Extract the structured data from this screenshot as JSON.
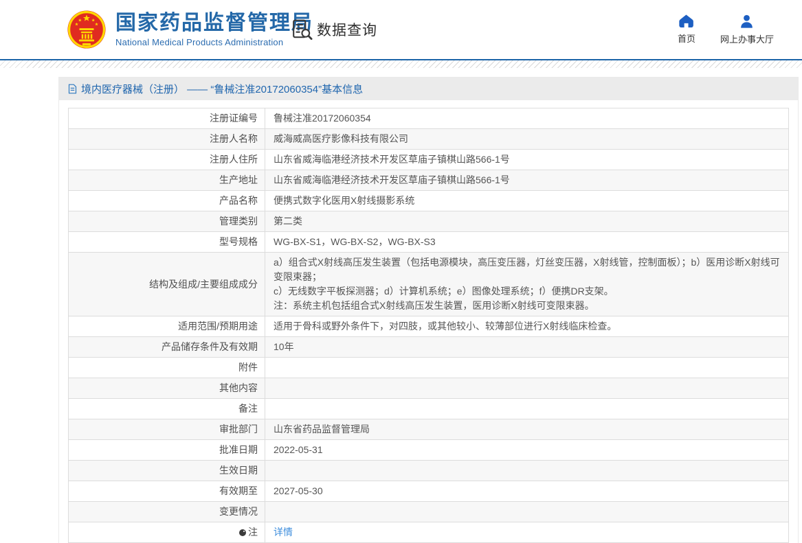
{
  "colors": {
    "accent_blue": "#2468a8",
    "icon_blue": "#1d5fc2",
    "link_blue": "#3e8edd",
    "emblem_red": "#e02b20",
    "emblem_gold": "#ffd700",
    "header_border_blue": "#1b64a8",
    "breadcrumb_bg": "#ebebeb",
    "zebra_gray": "#f7f7f7",
    "table_border": "#dcdcdc"
  },
  "header": {
    "site_title": "国家药品监督管理局",
    "site_subtitle": "National Medical Products Administration",
    "section_label": "数据查询",
    "nav": [
      {
        "label": "首页",
        "icon": "home-icon"
      },
      {
        "label": "网上办事大厅",
        "icon": "user-icon"
      }
    ]
  },
  "breadcrumb": {
    "icon": "page-icon",
    "title": "境内医疗器械（注册） —— “鲁械注准20172060354”基本信息"
  },
  "detail_table": {
    "rows": [
      {
        "label": "注册证编号",
        "value": "鲁械注准20172060354"
      },
      {
        "label": "注册人名称",
        "value": "威海威高医疗影像科技有限公司"
      },
      {
        "label": "注册人住所",
        "value": "山东省威海临港经济技术开发区草庙子镇棋山路566-1号"
      },
      {
        "label": "生产地址",
        "value": "山东省威海临港经济技术开发区草庙子镇棋山路566-1号"
      },
      {
        "label": "产品名称",
        "value": "便携式数字化医用X射线摄影系统"
      },
      {
        "label": "管理类别",
        "value": "第二类"
      },
      {
        "label": "型号规格",
        "value": "WG-BX-S1，WG-BX-S2，WG-BX-S3"
      },
      {
        "label": "结构及组成/主要组成成分",
        "value": "a）组合式X射线高压发生装置（包括电源模块，高压变压器，灯丝变压器，X射线管，控制面板）；b）医用诊断X射线可变限束器；\nc）无线数字平板探测器；d）计算机系统；e）图像处理系统；f）便携DR支架。\n注：系统主机包括组合式X射线高压发生装置，医用诊断X射线可变限束器。"
      },
      {
        "label": "适用范围/预期用途",
        "value": "适用于骨科或野外条件下，对四肢，或其他较小、较薄部位进行X射线临床检查。"
      },
      {
        "label": "产品储存条件及有效期",
        "value": "10年"
      },
      {
        "label": "附件",
        "value": ""
      },
      {
        "label": "其他内容",
        "value": ""
      },
      {
        "label": "备注",
        "value": ""
      },
      {
        "label": "审批部门",
        "value": "山东省药品监督管理局"
      },
      {
        "label": "批准日期",
        "value": "2022-05-31"
      },
      {
        "label": "生效日期",
        "value": ""
      },
      {
        "label": "有效期至",
        "value": "2027-05-30"
      },
      {
        "label": "变更情况",
        "value": ""
      },
      {
        "label": "注",
        "label_icon": "pin-icon",
        "value": "详情",
        "value_link": true
      }
    ]
  }
}
